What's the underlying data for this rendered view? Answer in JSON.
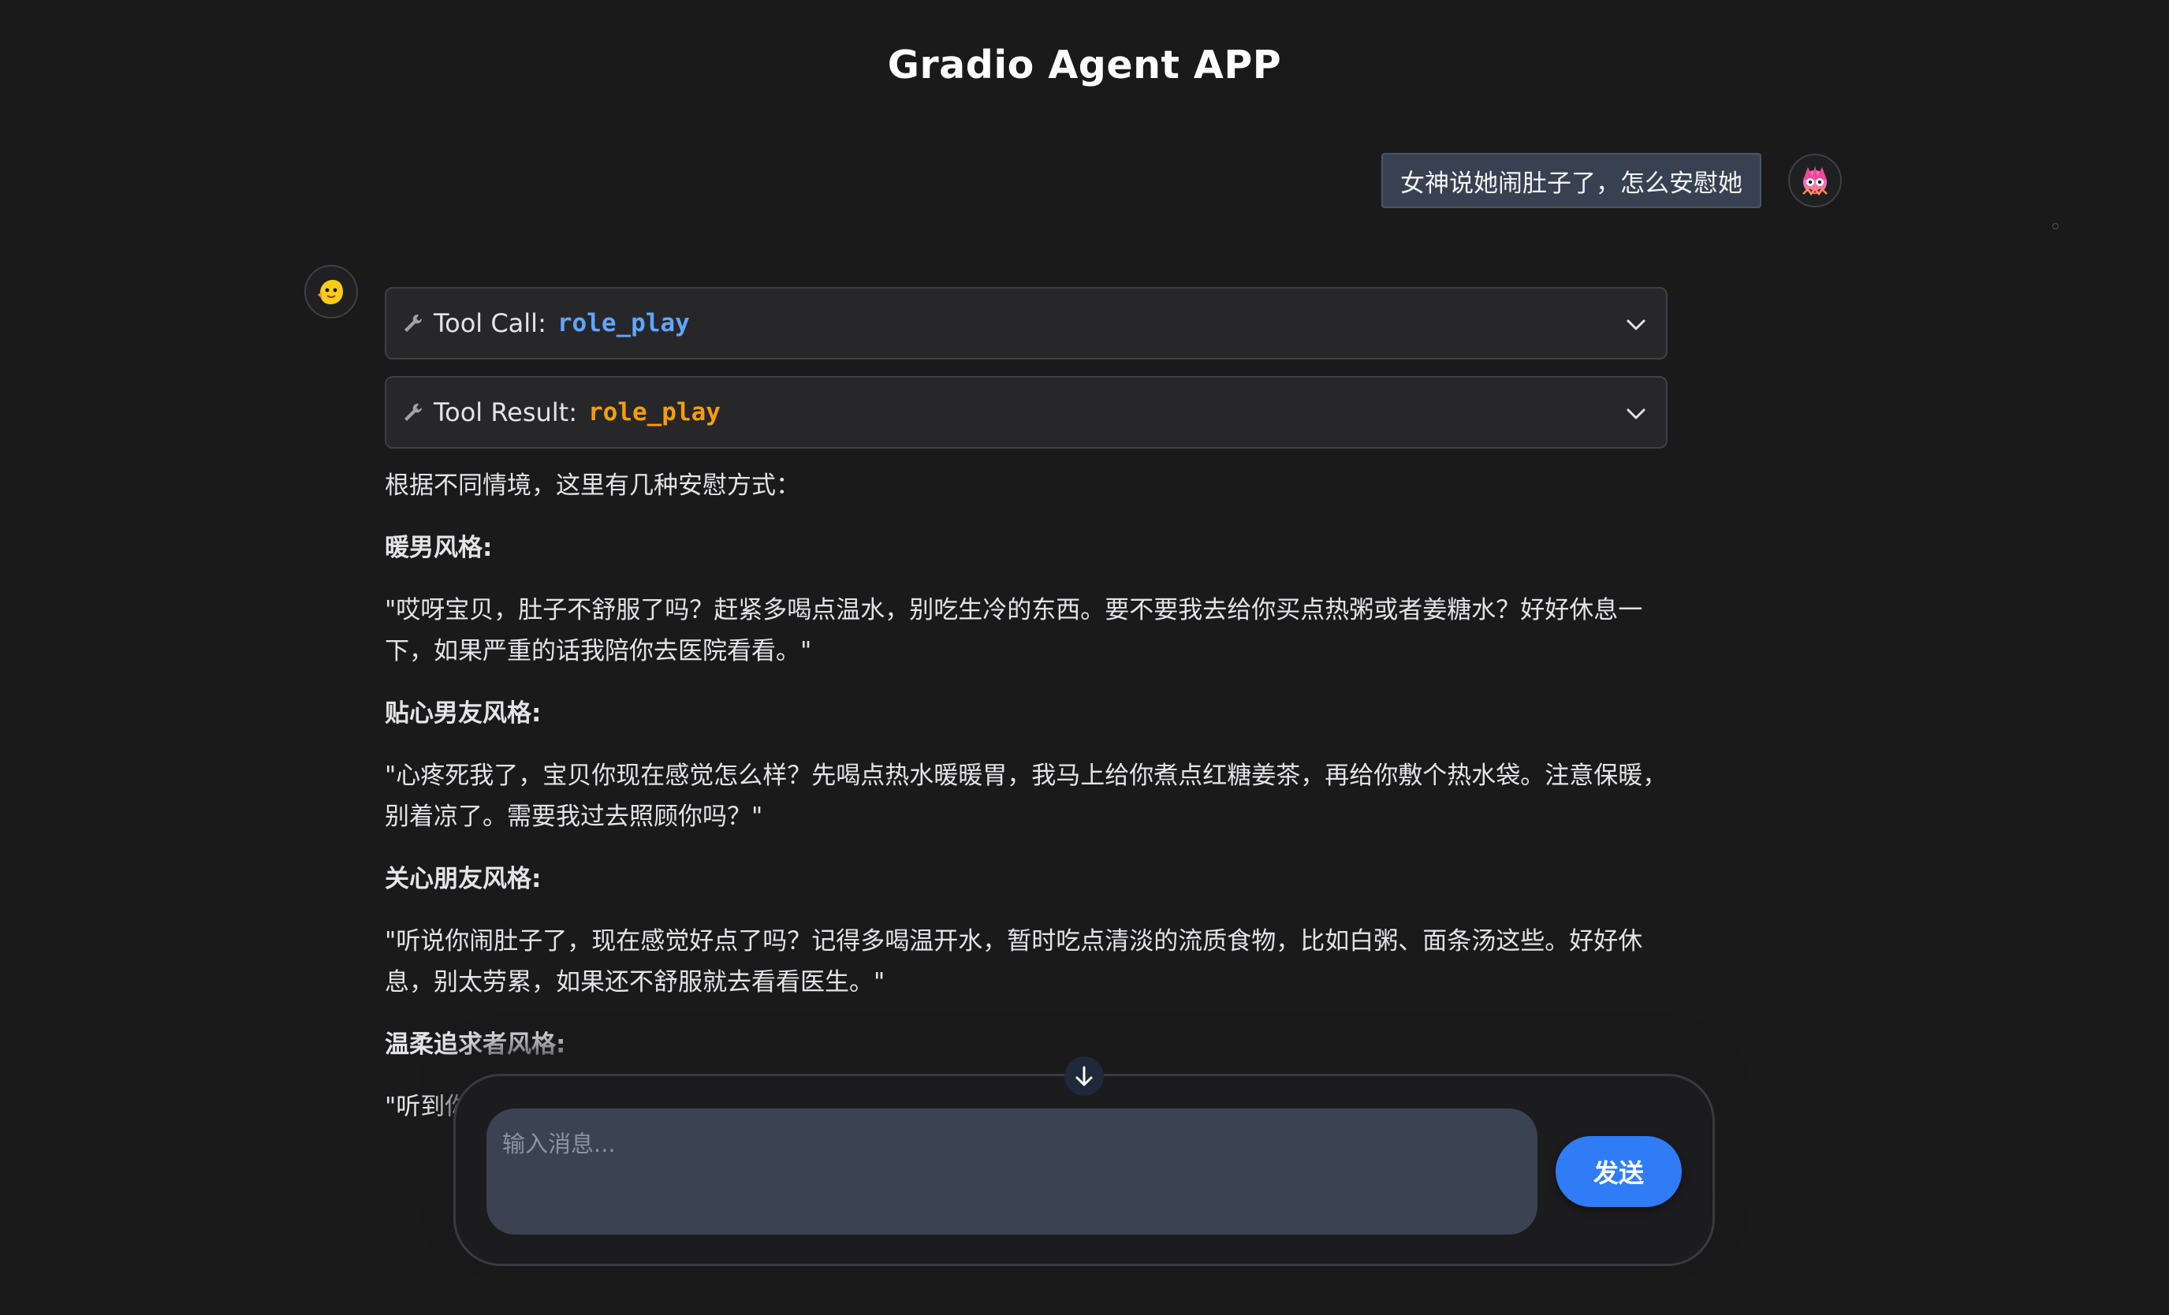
{
  "header": {
    "title": "Gradio Agent APP"
  },
  "user_message": {
    "text": "女神说她闹肚子了，怎么安慰她",
    "avatar_icon": "user-avatar-icon"
  },
  "bot": {
    "avatar_icon": "bot-avatar-icon",
    "tool_call": {
      "prefix": "Tool Call:",
      "name": "role_play"
    },
    "tool_result": {
      "prefix": "Tool Result:",
      "name": "role_play"
    },
    "paragraphs": [
      {
        "text": "根据不同情境，这里有几种安慰方式：",
        "heading": false
      },
      {
        "text": "暖男风格:",
        "heading": true
      },
      {
        "text": "\"哎呀宝贝，肚子不舒服了吗？赶紧多喝点温水，别吃生冷的东西。要不要我去给你买点热粥或者姜糖水？好好休息一下，如果严重的话我陪你去医院看看。\"",
        "heading": false
      },
      {
        "text": "贴心男友风格:",
        "heading": true
      },
      {
        "text": "\"心疼死我了，宝贝你现在感觉怎么样？先喝点热水暖暖胃，我马上给你煮点红糖姜茶，再给你敷个热水袋。注意保暖，别着凉了。需要我过去照顾你吗？\"",
        "heading": false
      },
      {
        "text": "关心朋友风格:",
        "heading": true
      },
      {
        "text": "\"听说你闹肚子了，现在感觉好点了吗？记得多喝温开水，暂时吃点清淡的流质食物，比如白粥、面条汤这些。好好休息，别太劳累，如果还不舒服就去看看医生。\"",
        "heading": false
      },
      {
        "text": "温柔追求者风格:",
        "heading": true
      },
      {
        "text": "\"听到你",
        "heading": false
      }
    ]
  },
  "composer": {
    "placeholder": "输入消息...",
    "send_label": "发送"
  },
  "colors": {
    "background": "#1a1a1b",
    "accent": "#2f7cf6",
    "tool_call_code": "#60a5fa",
    "tool_result_code": "#f59e0b"
  }
}
